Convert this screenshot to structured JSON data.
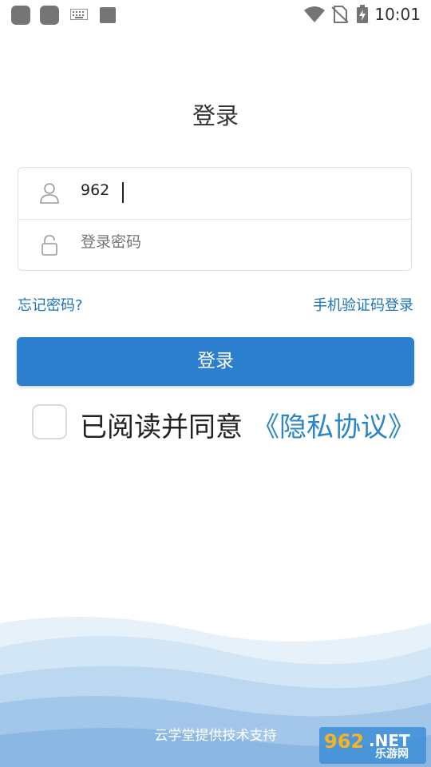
{
  "status_bar": {
    "time": "10:01"
  },
  "page": {
    "title": "登录"
  },
  "form": {
    "username_value": "962",
    "password_placeholder": "登录密码"
  },
  "links": {
    "forgot_password": "忘记密码?",
    "sms_login": "手机验证码登录"
  },
  "login_button": "登录",
  "agreement": {
    "text": "已阅读并同意",
    "link": "《隐私协议》"
  },
  "footer": "云学堂提供技术支持",
  "watermark": {
    "brand": "962.NET",
    "subtitle": "乐游网"
  },
  "colors": {
    "primary": "#2b7fce",
    "link": "#1a73b8",
    "wave": "#bcd8f0"
  }
}
